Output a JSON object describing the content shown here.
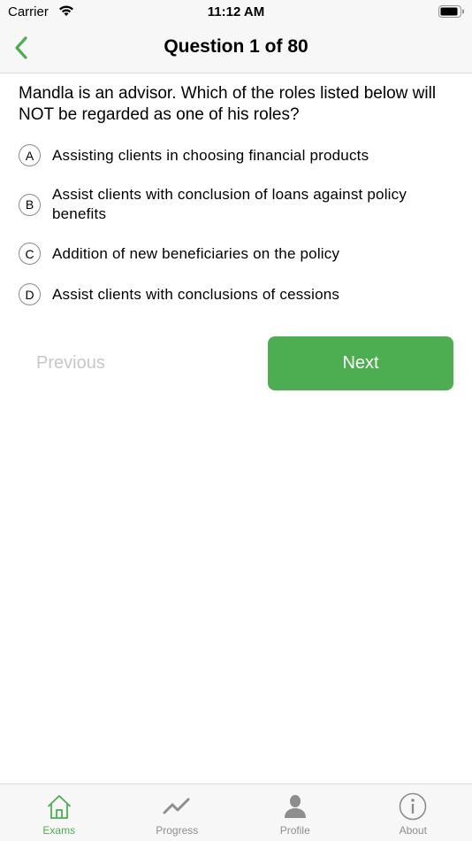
{
  "status_bar": {
    "carrier": "Carrier",
    "time": "11:12 AM"
  },
  "nav": {
    "title": "Question 1 of 80",
    "back_icon": "chevron-left-icon"
  },
  "question": {
    "text": "Mandla is an advisor. Which of the roles listed below will NOT be regarded as one of his roles?"
  },
  "options": [
    {
      "letter": "A",
      "text": "Assisting clients in choosing financial products"
    },
    {
      "letter": "B",
      "text": "Assist clients with conclusion of loans against policy benefits"
    },
    {
      "letter": "C",
      "text": "Addition of new beneficiaries on the policy"
    },
    {
      "letter": "D",
      "text": "Assist clients with conclusions of cessions"
    }
  ],
  "buttons": {
    "previous": "Previous",
    "next": "Next"
  },
  "tabs": [
    {
      "label": "Exams",
      "icon": "home-icon",
      "active": true
    },
    {
      "label": "Progress",
      "icon": "trend-icon",
      "active": false
    },
    {
      "label": "Profile",
      "icon": "person-icon",
      "active": false
    },
    {
      "label": "About",
      "icon": "info-icon",
      "active": false
    }
  ],
  "colors": {
    "accent": "#4cae50",
    "disabled_text": "#c7c7c7",
    "inactive_tab": "#8e8e8e"
  }
}
